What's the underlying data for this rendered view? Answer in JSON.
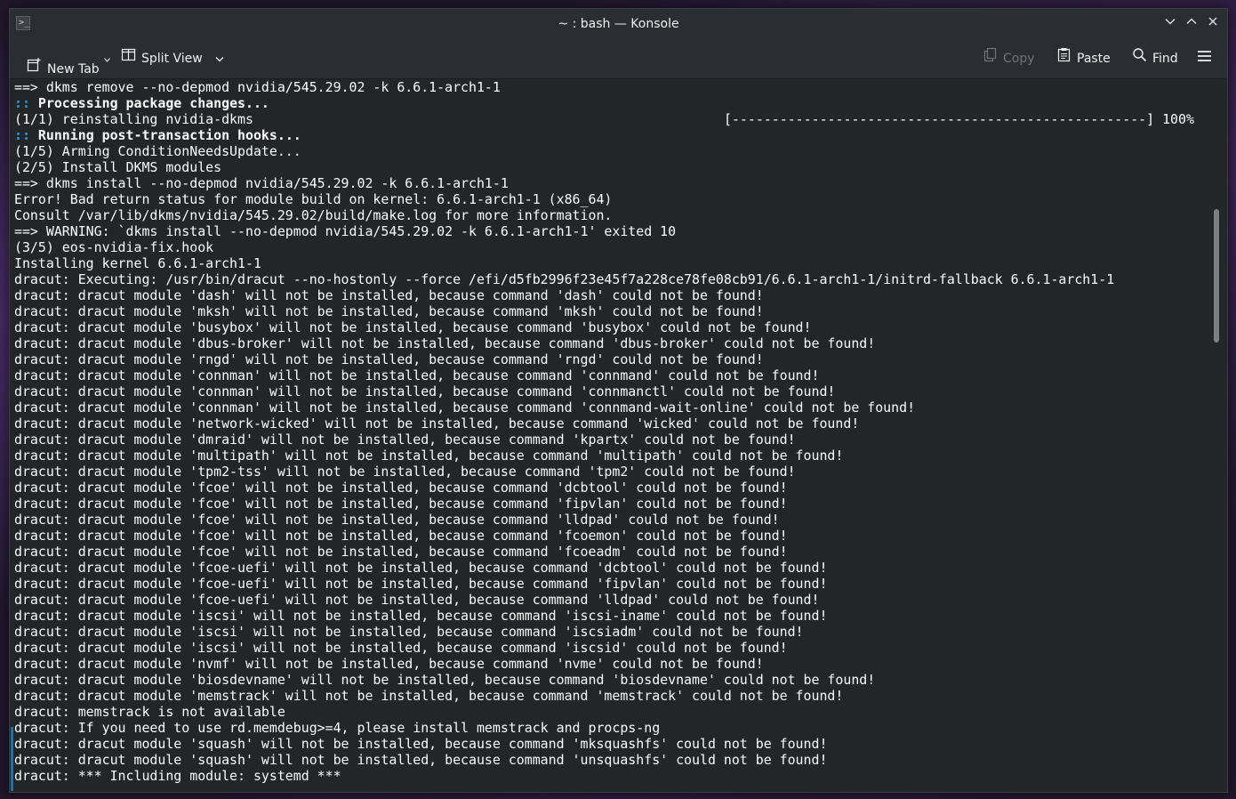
{
  "window": {
    "title": "~ : bash — Konsole",
    "app_icon_glyph": ">_"
  },
  "toolbar": {
    "new_tab_label": "New Tab",
    "split_view_label": "Split View",
    "copy_label": "Copy",
    "paste_label": "Paste",
    "find_label": "Find"
  },
  "terminal": {
    "progress": "[----------------------------------------------------] 100%",
    "lines": [
      {
        "t": "==> dkms remove --no-depmod nvidia/545.29.02 -k 6.6.1-arch1-1"
      },
      {
        "p": ":: ",
        "b": "Processing package changes..."
      },
      {
        "t": "(1/1) reinstalling nvidia-dkms"
      },
      {
        "p": ":: ",
        "b": "Running post-transaction hooks..."
      },
      {
        "t": "(1/5) Arming ConditionNeedsUpdate..."
      },
      {
        "t": "(2/5) Install DKMS modules"
      },
      {
        "t": "==> dkms install --no-depmod nvidia/545.29.02 -k 6.6.1-arch1-1"
      },
      {
        "t": "Error! Bad return status for module build on kernel: 6.6.1-arch1-1 (x86_64)"
      },
      {
        "t": "Consult /var/lib/dkms/nvidia/545.29.02/build/make.log for more information."
      },
      {
        "t": "==> WARNING: `dkms install --no-depmod nvidia/545.29.02 -k 6.6.1-arch1-1' exited 10"
      },
      {
        "t": "(3/5) eos-nvidia-fix.hook"
      },
      {
        "t": "Installing kernel 6.6.1-arch1-1"
      },
      {
        "t": "dracut: Executing: /usr/bin/dracut --no-hostonly --force /efi/d5fb2996f23e45f7a228ce78fe08cb91/6.6.1-arch1-1/initrd-fallback 6.6.1-arch1-1"
      },
      {
        "t": "dracut: dracut module 'dash' will not be installed, because command 'dash' could not be found!"
      },
      {
        "t": "dracut: dracut module 'mksh' will not be installed, because command 'mksh' could not be found!"
      },
      {
        "t": "dracut: dracut module 'busybox' will not be installed, because command 'busybox' could not be found!"
      },
      {
        "t": "dracut: dracut module 'dbus-broker' will not be installed, because command 'dbus-broker' could not be found!"
      },
      {
        "t": "dracut: dracut module 'rngd' will not be installed, because command 'rngd' could not be found!"
      },
      {
        "t": "dracut: dracut module 'connman' will not be installed, because command 'connmand' could not be found!"
      },
      {
        "t": "dracut: dracut module 'connman' will not be installed, because command 'connmanctl' could not be found!"
      },
      {
        "t": "dracut: dracut module 'connman' will not be installed, because command 'connmand-wait-online' could not be found!"
      },
      {
        "t": "dracut: dracut module 'network-wicked' will not be installed, because command 'wicked' could not be found!"
      },
      {
        "t": "dracut: dracut module 'dmraid' will not be installed, because command 'kpartx' could not be found!"
      },
      {
        "t": "dracut: dracut module 'multipath' will not be installed, because command 'multipath' could not be found!"
      },
      {
        "t": "dracut: dracut module 'tpm2-tss' will not be installed, because command 'tpm2' could not be found!"
      },
      {
        "t": "dracut: dracut module 'fcoe' will not be installed, because command 'dcbtool' could not be found!"
      },
      {
        "t": "dracut: dracut module 'fcoe' will not be installed, because command 'fipvlan' could not be found!"
      },
      {
        "t": "dracut: dracut module 'fcoe' will not be installed, because command 'lldpad' could not be found!"
      },
      {
        "t": "dracut: dracut module 'fcoe' will not be installed, because command 'fcoemon' could not be found!"
      },
      {
        "t": "dracut: dracut module 'fcoe' will not be installed, because command 'fcoeadm' could not be found!"
      },
      {
        "t": "dracut: dracut module 'fcoe-uefi' will not be installed, because command 'dcbtool' could not be found!"
      },
      {
        "t": "dracut: dracut module 'fcoe-uefi' will not be installed, because command 'fipvlan' could not be found!"
      },
      {
        "t": "dracut: dracut module 'fcoe-uefi' will not be installed, because command 'lldpad' could not be found!"
      },
      {
        "t": "dracut: dracut module 'iscsi' will not be installed, because command 'iscsi-iname' could not be found!"
      },
      {
        "t": "dracut: dracut module 'iscsi' will not be installed, because command 'iscsiadm' could not be found!"
      },
      {
        "t": "dracut: dracut module 'iscsi' will not be installed, because command 'iscsid' could not be found!"
      },
      {
        "t": "dracut: dracut module 'nvmf' will not be installed, because command 'nvme' could not be found!"
      },
      {
        "t": "dracut: dracut module 'biosdevname' will not be installed, because command 'biosdevname' could not be found!"
      },
      {
        "t": "dracut: dracut module 'memstrack' will not be installed, because command 'memstrack' could not be found!"
      },
      {
        "t": "dracut: memstrack is not available"
      },
      {
        "t": "dracut: If you need to use rd.memdebug>=4, please install memstrack and procps-ng"
      },
      {
        "t": "dracut: dracut module 'squash' will not be installed, because command 'mksquashfs' could not be found!"
      },
      {
        "t": "dracut: dracut module 'squash' will not be installed, because command 'unsquashfs' could not be found!"
      },
      {
        "t": "dracut: *** Including module: systemd ***"
      }
    ]
  },
  "colors": {
    "accent": "#1d99f3",
    "terminal_bg": "#232627",
    "terminal_fg": "#fcfcfc",
    "chrome_bg": "#2a2e32"
  }
}
